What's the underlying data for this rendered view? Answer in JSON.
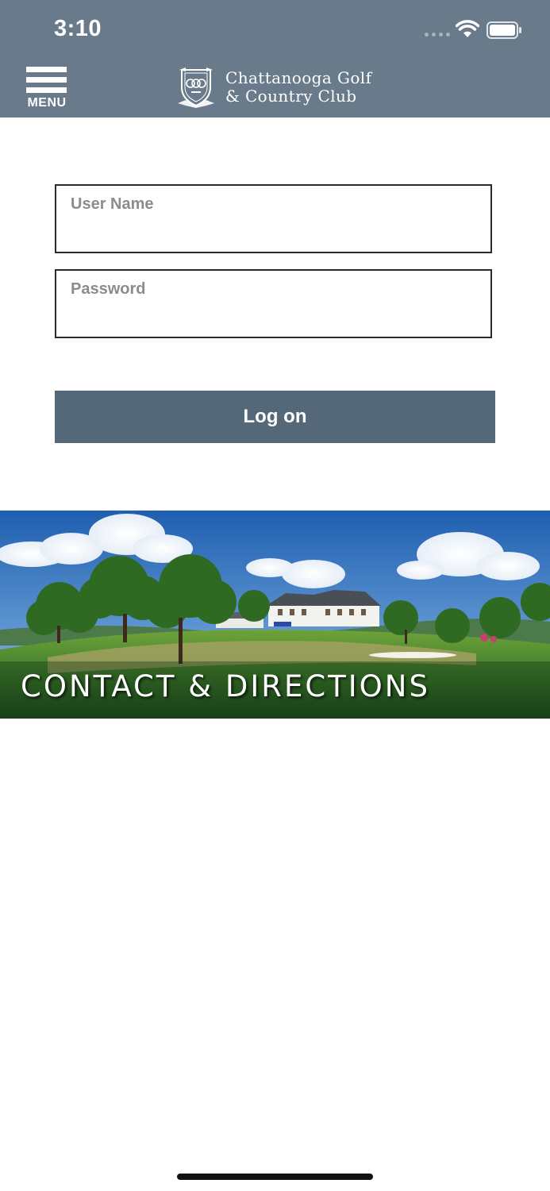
{
  "status_bar": {
    "time": "3:10"
  },
  "header": {
    "menu_label": "MENU",
    "club_name_line1": "Chattanooga Golf",
    "club_name_line2": "& Country Club",
    "logo_icon": "club-crest-icon",
    "background_color": "#697b8b"
  },
  "login": {
    "username_placeholder": "User Name",
    "password_placeholder": "Password",
    "button_label": "Log on",
    "button_color": "#54687a"
  },
  "banner": {
    "label": "CONTACT & DIRECTIONS"
  }
}
